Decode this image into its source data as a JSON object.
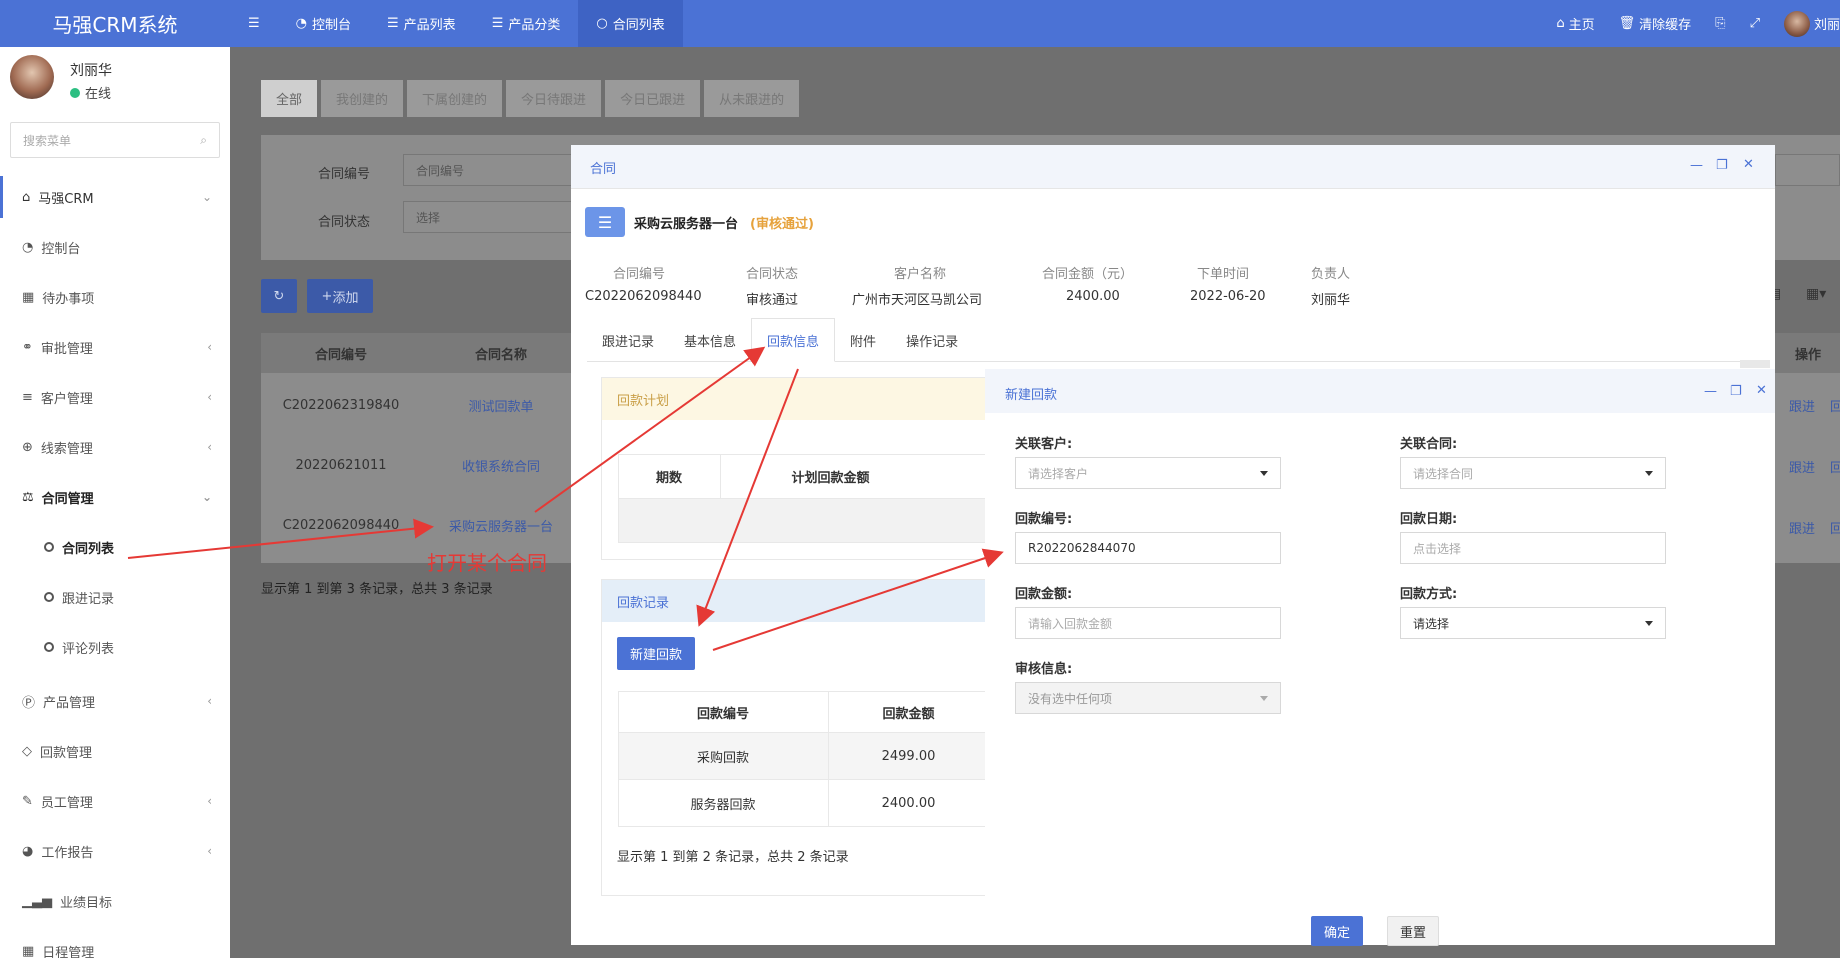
{
  "app": {
    "title": "马强CRM系统"
  },
  "topnav": [
    {
      "icon": "hamburger-icon",
      "label": ""
    },
    {
      "icon": "dashboard-icon",
      "label": "控制台"
    },
    {
      "icon": "list-icon",
      "label": "产品列表"
    },
    {
      "icon": "list-icon",
      "label": "产品分类"
    },
    {
      "icon": "circle-icon",
      "label": "合同列表"
    }
  ],
  "topright": {
    "home": "主页",
    "clear_cache": "清除缓存",
    "user": "刘丽"
  },
  "user": {
    "name": "刘丽华",
    "status": "在线"
  },
  "sidebar": {
    "search_placeholder": "搜索菜单",
    "items": [
      {
        "label": "马强CRM",
        "icon": "home-icon"
      },
      {
        "label": "控制台",
        "icon": "dashboard-icon"
      },
      {
        "label": "待办事项",
        "icon": "calendar-icon"
      },
      {
        "label": "审批管理",
        "icon": "handshake-icon"
      },
      {
        "label": "客户管理",
        "icon": "sliders-icon"
      },
      {
        "label": "线索管理",
        "icon": "search-plus-icon"
      },
      {
        "label": "合同管理",
        "icon": "balance-scale-icon"
      },
      {
        "label": "合同列表",
        "icon": "ring-icon"
      },
      {
        "label": "跟进记录",
        "icon": "ring-icon"
      },
      {
        "label": "评论列表",
        "icon": "ring-icon"
      },
      {
        "label": "产品管理",
        "icon": "p-circle-icon"
      },
      {
        "label": "回款管理",
        "icon": "diamond-icon"
      },
      {
        "label": "员工管理",
        "icon": "brush-icon"
      },
      {
        "label": "工作报告",
        "icon": "pie-icon"
      },
      {
        "label": "业绩目标",
        "icon": "bar-chart-icon"
      },
      {
        "label": "日程管理",
        "icon": "calendar-icon"
      }
    ]
  },
  "list": {
    "tabs": [
      "全部",
      "我创建的",
      "下属创建的",
      "今日待跟进",
      "今日已跟进",
      "从未跟进的"
    ],
    "filter": {
      "contract_no_label": "合同编号",
      "contract_no_placeholder": "合同编号",
      "status_label": "合同状态",
      "status_value": "选择"
    },
    "add_button": "添加",
    "columns": [
      "合同编号",
      "合同名称",
      "操作"
    ],
    "rows": [
      {
        "no": "C2022062319840",
        "name": "测试回款单",
        "a1": "跟进",
        "a2": "回"
      },
      {
        "no": "20220621011",
        "name": "收银系统合同",
        "a1": "跟进",
        "a2": "回"
      },
      {
        "no": "C2022062098440",
        "name": "采购云服务器一台",
        "a1": "跟进",
        "a2": "回"
      }
    ],
    "footer": "显示第 1 到第 3 条记录，总共 3 条记录"
  },
  "contract_modal": {
    "title": "合同",
    "name": "采购云服务器一台",
    "status_tag": "(审核通过)",
    "fields": [
      {
        "label": "合同编号",
        "value": "C2022062098440"
      },
      {
        "label": "合同状态",
        "value": "审核通过"
      },
      {
        "label": "客户名称",
        "value": "广州市天河区马凯公司"
      },
      {
        "label": "合同金额（元）",
        "value": "2400.00"
      },
      {
        "label": "下单时间",
        "value": "2022-06-20"
      },
      {
        "label": "负责人",
        "value": "刘丽华"
      }
    ],
    "tabs": [
      "跟进记录",
      "基本信息",
      "回款信息",
      "附件",
      "操作记录"
    ],
    "plan": {
      "title": "回款计划",
      "columns": [
        "期数",
        "计划回款金额"
      ]
    },
    "records": {
      "title": "回款记录",
      "new_button": "新建回款",
      "columns": [
        "回款编号",
        "回款金额"
      ],
      "rows": [
        {
          "no": "采购回款",
          "amount": "2499.00"
        },
        {
          "no": "服务器回款",
          "amount": "2400.00"
        }
      ],
      "footer": "显示第 1 到第 2 条记录，总共 2 条记录"
    }
  },
  "payment_modal": {
    "title": "新建回款",
    "customer_label": "关联客户:",
    "customer_placeholder": "请选择客户",
    "contract_label": "关联合同:",
    "contract_placeholder": "请选择合同",
    "no_label": "回款编号:",
    "no_value": "R2022062844070",
    "date_label": "回款日期:",
    "date_placeholder": "点击选择",
    "amount_label": "回款金额:",
    "amount_placeholder": "请输入回款金额",
    "method_label": "回款方式:",
    "method_value": "请选择",
    "audit_label": "审核信息:",
    "audit_placeholder": "没有选中任何项",
    "confirm": "确定",
    "reset": "重置"
  },
  "annotation": {
    "text": "打开某个合同",
    "color": "#e53935"
  }
}
